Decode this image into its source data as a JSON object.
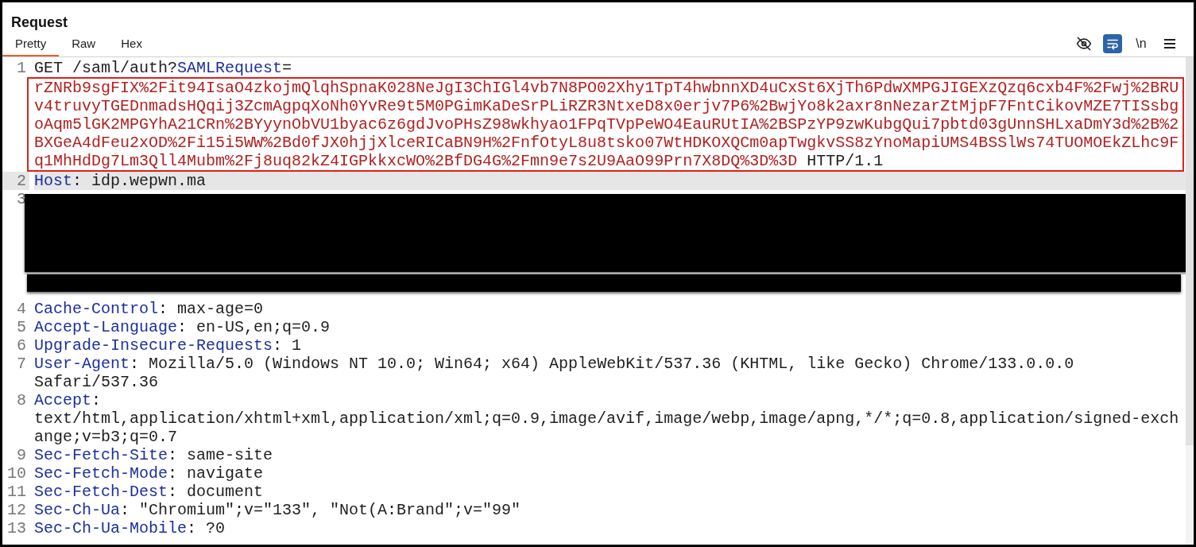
{
  "panel": {
    "title": "Request"
  },
  "tabs": [
    {
      "label": "Pretty",
      "selected": true
    },
    {
      "label": "Raw",
      "selected": false
    },
    {
      "label": "Hex",
      "selected": false
    }
  ],
  "toolbar": [
    {
      "kind": "eye-off",
      "active": false
    },
    {
      "kind": "wrap",
      "active": true
    },
    {
      "kind": "text",
      "label": "\\n",
      "active": false
    },
    {
      "kind": "menu",
      "active": false
    }
  ],
  "lines": [
    {
      "number": "1",
      "kind": "code",
      "current": false,
      "rows": [
        {
          "highlighted": false,
          "parts": [
            {
              "kind": "plain",
              "text": "GET /saml/auth?"
            },
            {
              "kind": "param",
              "text": "SAMLRequest"
            },
            {
              "kind": "plain",
              "text": "="
            }
          ]
        },
        {
          "highlighted": true,
          "parts": [
            {
              "kind": "encoded",
              "text": "rZNRb9sgFIX%2Fit94IsaO4zkojmQlqhSpnaK028NeJgI3ChIGl4vb7N8PO02Xhy1TpT4hwbnnXD4uCxSt6XjTh6PdwXMPGJIGEXzQzq6cxb4F%2Fwj%2BRU"
            }
          ]
        },
        {
          "highlighted": true,
          "parts": [
            {
              "kind": "encoded",
              "text": "v4truvyTGEDnmadsHQqij3ZcmAgpqXoNh0YvRe9t5M0PGimKaDeSrPLiRZR3NtxeD8x0erjv7P6%2BwjYo8k2axr8nNezarZtMjpF7FntCikovMZE7TISsbg"
            }
          ]
        },
        {
          "highlighted": true,
          "parts": [
            {
              "kind": "encoded",
              "text": "oAqm5lGK2MPGYhA21CRn%2BYyynObVU1byac6z6gdJvoPHsZ98wkhyao1FPqTVpPeWO4EauRUtIA%2BSPzYP9zwKubgQui7pbtd03gUnnSHLxaDmY3d%2B%2"
            }
          ]
        },
        {
          "highlighted": true,
          "parts": [
            {
              "kind": "encoded",
              "text": "BXGeA4dFeu2xOD%2Fi15i5WW%2Bd0fJX0hjjXlceRICaBN9H%2FnfOtyL8u8tsko07WtHDKOXQCm0apTwgkvSS8zYnoMapiUMS4BSSlWs74TUOMOEkZLhc9F"
            }
          ]
        },
        {
          "highlighted": true,
          "parts": [
            {
              "kind": "encoded",
              "text": "q1MhHdDg7Lm3Qll4Mubm%2Fj8uq82kZ4IGPkkxcWO%2BfDG4G%2Fmn9e7s2U9AaO99Prn7X8DQ%3D%3D"
            },
            {
              "kind": "plain",
              "text": " HTTP/1.1"
            }
          ]
        }
      ]
    },
    {
      "number": "2",
      "kind": "code",
      "current": true,
      "rows": [
        {
          "highlighted": false,
          "parts": [
            {
              "kind": "key",
              "text": "Host"
            },
            {
              "kind": "plain",
              "text": ": idp.wepwn.ma"
            }
          ]
        }
      ]
    },
    {
      "number": "3",
      "kind": "redacted",
      "current": false
    },
    {
      "number": "4",
      "kind": "code",
      "current": false,
      "rows": [
        {
          "highlighted": false,
          "parts": [
            {
              "kind": "key",
              "text": "Cache-Control"
            },
            {
              "kind": "plain",
              "text": ": max-age=0"
            }
          ]
        }
      ]
    },
    {
      "number": "5",
      "kind": "code",
      "current": false,
      "rows": [
        {
          "highlighted": false,
          "parts": [
            {
              "kind": "key",
              "text": "Accept-Language"
            },
            {
              "kind": "plain",
              "text": ": en-US,en;q=0.9"
            }
          ]
        }
      ]
    },
    {
      "number": "6",
      "kind": "code",
      "current": false,
      "rows": [
        {
          "highlighted": false,
          "parts": [
            {
              "kind": "key",
              "text": "Upgrade-Insecure-Requests"
            },
            {
              "kind": "plain",
              "text": ": 1"
            }
          ]
        }
      ]
    },
    {
      "number": "7",
      "kind": "code",
      "current": false,
      "rows": [
        {
          "highlighted": false,
          "parts": [
            {
              "kind": "key",
              "text": "User-Agent"
            },
            {
              "kind": "plain",
              "text": ": Mozilla/5.0 (Windows NT 10.0; Win64; x64) AppleWebKit/537.36 (KHTML, like Gecko) Chrome/133.0.0.0"
            }
          ]
        },
        {
          "highlighted": false,
          "parts": [
            {
              "kind": "plain",
              "text": "Safari/537.36"
            }
          ]
        }
      ]
    },
    {
      "number": "8",
      "kind": "code",
      "current": false,
      "rows": [
        {
          "highlighted": false,
          "parts": [
            {
              "kind": "key",
              "text": "Accept"
            },
            {
              "kind": "plain",
              "text": ":"
            }
          ]
        },
        {
          "highlighted": false,
          "parts": [
            {
              "kind": "plain",
              "text": "text/html,application/xhtml+xml,application/xml;q=0.9,image/avif,image/webp,image/apng,*/*;q=0.8,application/signed-exch"
            }
          ]
        },
        {
          "highlighted": false,
          "parts": [
            {
              "kind": "plain",
              "text": "ange;v=b3;q=0.7"
            }
          ]
        }
      ]
    },
    {
      "number": "9",
      "kind": "code",
      "current": false,
      "rows": [
        {
          "highlighted": false,
          "parts": [
            {
              "kind": "key",
              "text": "Sec-Fetch-Site"
            },
            {
              "kind": "plain",
              "text": ": same-site"
            }
          ]
        }
      ]
    },
    {
      "number": "10",
      "kind": "code",
      "current": false,
      "rows": [
        {
          "highlighted": false,
          "parts": [
            {
              "kind": "key",
              "text": "Sec-Fetch-Mode"
            },
            {
              "kind": "plain",
              "text": ": navigate"
            }
          ]
        }
      ]
    },
    {
      "number": "11",
      "kind": "code",
      "current": false,
      "rows": [
        {
          "highlighted": false,
          "parts": [
            {
              "kind": "key",
              "text": "Sec-Fetch-Dest"
            },
            {
              "kind": "plain",
              "text": ": document"
            }
          ]
        }
      ]
    },
    {
      "number": "12",
      "kind": "code",
      "current": false,
      "rows": [
        {
          "highlighted": false,
          "parts": [
            {
              "kind": "key",
              "text": "Sec-Ch-Ua"
            },
            {
              "kind": "plain",
              "text": ": \"Chromium\";v=\"133\", \"Not(A:Brand\";v=\"99\""
            }
          ]
        }
      ]
    },
    {
      "number": "13",
      "kind": "code",
      "current": false,
      "rows": [
        {
          "highlighted": false,
          "parts": [
            {
              "kind": "key",
              "text": "Sec-Ch-Ua-Mobile"
            },
            {
              "kind": "plain",
              "text": ": ?0"
            }
          ]
        }
      ]
    }
  ]
}
